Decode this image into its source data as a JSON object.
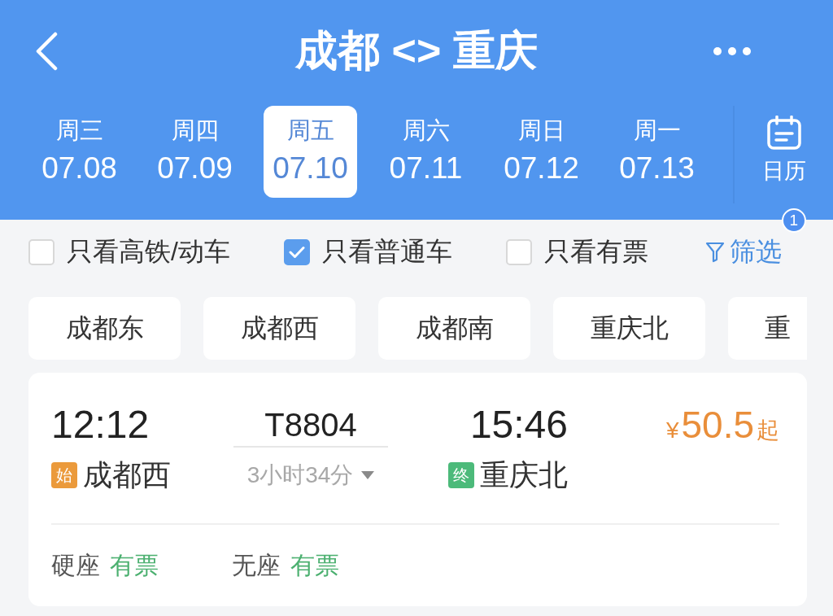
{
  "header": {
    "title": "成都 <> 重庆"
  },
  "dates": [
    {
      "weekday": "周三",
      "date": "07.08",
      "selected": false
    },
    {
      "weekday": "周四",
      "date": "07.09",
      "selected": false
    },
    {
      "weekday": "周五",
      "date": "07.10",
      "selected": true
    },
    {
      "weekday": "周六",
      "date": "07.11",
      "selected": false
    },
    {
      "weekday": "周日",
      "date": "07.12",
      "selected": false
    },
    {
      "weekday": "周一",
      "date": "07.13",
      "selected": false
    }
  ],
  "calendar_button": {
    "label": "日历"
  },
  "filters": [
    {
      "label": "只看高铁/动车",
      "checked": false
    },
    {
      "label": "只看普通车",
      "checked": true
    },
    {
      "label": "只看有票",
      "checked": false
    }
  ],
  "filter_button": {
    "label": "筛选",
    "badge": "1"
  },
  "stations": [
    "成都东",
    "成都西",
    "成都南",
    "重庆北",
    "重"
  ],
  "trains": [
    {
      "departure": {
        "time": "12:12",
        "tag": "始",
        "station": "成都西"
      },
      "train_number": "T8804",
      "duration": "3小时34分",
      "arrival": {
        "time": "15:46",
        "tag": "终",
        "station": "重庆北"
      },
      "price": {
        "currency": "¥",
        "amount": "50.5",
        "suffix": "起"
      },
      "seats": [
        {
          "class": "硬座",
          "status": "有票"
        },
        {
          "class": "无座",
          "status": "有票"
        }
      ]
    }
  ]
}
